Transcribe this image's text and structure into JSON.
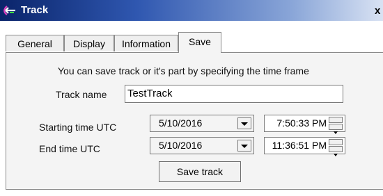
{
  "window": {
    "title": "Track",
    "close_label": "x",
    "icon": "track-app-icon"
  },
  "tabs": [
    {
      "label": "General"
    },
    {
      "label": "Display"
    },
    {
      "label": "Information"
    },
    {
      "label": "Save"
    }
  ],
  "active_tab": "Save",
  "save_panel": {
    "description": "You can save track or it's part by specifying the time frame",
    "track_name_label": "Track name",
    "track_name_value": "TestTrack",
    "start_label": "Starting time UTC",
    "start_date": "5/10/2016",
    "start_time": "7:50:33 PM",
    "end_label": "End time UTC",
    "end_date": "5/10/2016",
    "end_time": "11:36:51 PM",
    "save_button_label": "Save track"
  },
  "colors": {
    "titlebar_start": "#0a246a",
    "titlebar_end": "#dfe7f5",
    "panel_background": "#f4f4f4"
  }
}
